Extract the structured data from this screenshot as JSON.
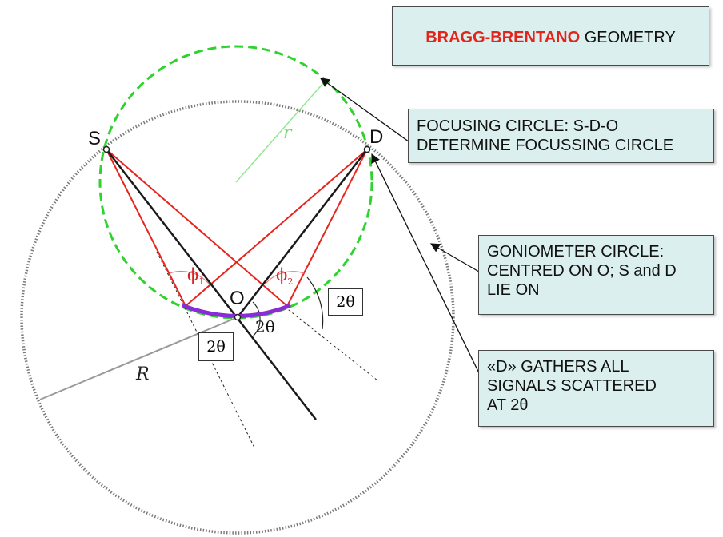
{
  "title": {
    "accent": "BRAGG-BRENTANO",
    "rest": " GEOMETRY"
  },
  "callouts": {
    "focusing": [
      "FOCUSING CIRCLE: S-D-O",
      "DETERMINE FOCUSSING CIRCLE"
    ],
    "goniometer": [
      "GONIOMETER CIRCLE:",
      "CENTRED ON O; S and D",
      "LIE ON"
    ],
    "detector": [
      "«D» GATHERS ALL",
      "SIGNALS SCATTERED",
      "AT 2θ"
    ]
  },
  "labels": {
    "source": "S",
    "detector": "D",
    "origin": "O",
    "two_theta": "2θ",
    "small_radius": "r",
    "big_radius": "R",
    "phi": "ϕ",
    "phi1_sub": "1",
    "phi2_sub": "2"
  },
  "angle_boxes": {
    "right": "2θ",
    "left": "2θ"
  },
  "colors": {
    "focusing_circle": "#2fd22f",
    "goniometer_circle": "#888888",
    "incident_rays": "#e8241c",
    "main_beams": "#1a1a1a",
    "sample": "#8a2bd8",
    "radius_r": "#90e890",
    "title_accent": "#e2241b",
    "callout_bg": "#dcefef"
  }
}
